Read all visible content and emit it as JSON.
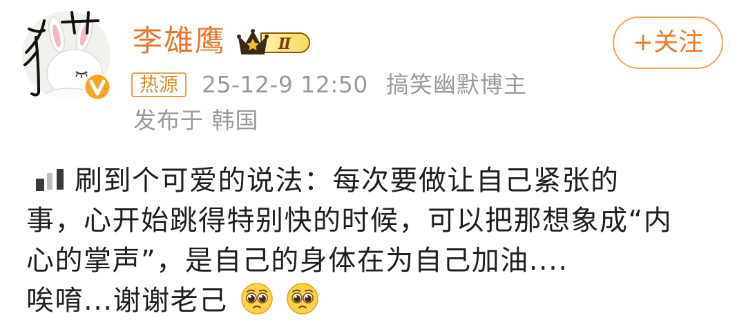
{
  "post": {
    "author": {
      "name": "李雄鹰",
      "badge_level": "Ⅱ",
      "follow_label": "+关注"
    },
    "meta": {
      "hot_tag": "热源",
      "timestamp": "25-12-9 12:50",
      "user_description": "搞笑幽默博主",
      "location": "发布于 韩国"
    },
    "body": {
      "line1": "刷到个可爱的说法：每次要做让自己紧张的",
      "line2": "事，心开始跳得特别快的时候，可以把那想象成“内",
      "line3": "心的掌声”，是自己的身体在为自己加油....",
      "line4": "唉唷...谢谢老己"
    },
    "icons": {
      "avatar": "bunny-avatar-icon",
      "verified": "verified-v-icon",
      "crown": "crown-badge-icon",
      "emoji": "pleading-face-icon"
    },
    "colors": {
      "accent_orange": "#e8772b",
      "meta_gray": "#9a9a9a",
      "body_text": "#1f1f1f",
      "badge_gold": "#e8b928"
    }
  }
}
